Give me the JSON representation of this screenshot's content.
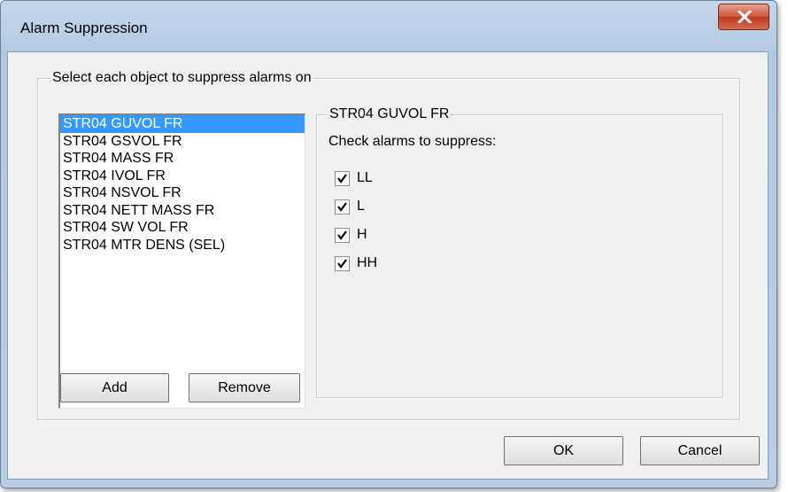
{
  "window": {
    "title": "Alarm Suppression"
  },
  "objects_group": {
    "legend": "Select each object to suppress alarms on",
    "items": [
      "STR04 GUVOL FR",
      "STR04 GSVOL FR",
      "STR04 MASS FR",
      "STR04 IVOL FR",
      "STR04 NSVOL FR",
      "STR04 NETT MASS FR",
      "STR04 SW VOL FR",
      "STR04 MTR DENS (SEL)"
    ],
    "selected_item": "STR04 GUVOL FR",
    "add_label": "Add",
    "remove_label": "Remove"
  },
  "alarm_group": {
    "legend": "STR04 GUVOL FR",
    "instruction": "Check alarms to suppress:",
    "alarms": [
      {
        "label": "LL",
        "checked": true
      },
      {
        "label": "L",
        "checked": true
      },
      {
        "label": "H",
        "checked": true
      },
      {
        "label": "HH",
        "checked": true
      }
    ]
  },
  "footer": {
    "ok_label": "OK",
    "cancel_label": "Cancel"
  },
  "colors": {
    "selection": "#3399ff",
    "close_button": "#c9462c",
    "dialog_bg": "#f0f0f0",
    "frame": "#b9cde3"
  },
  "icons": {
    "close": "close-x-icon",
    "check": "checkmark-icon"
  }
}
